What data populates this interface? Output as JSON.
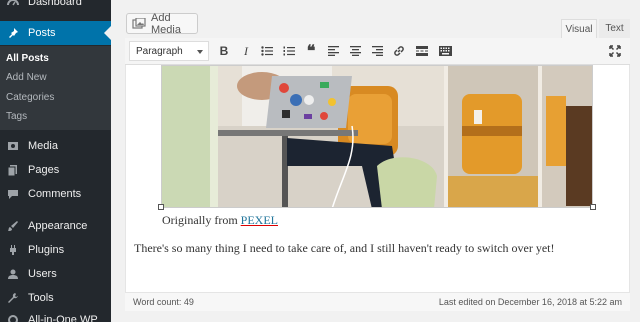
{
  "sidebar": {
    "items": [
      {
        "label": "Dashboard",
        "icon": "dashboard-icon"
      },
      {
        "label": "Posts",
        "icon": "pin-icon"
      },
      {
        "label": "Media",
        "icon": "media-icon"
      },
      {
        "label": "Pages",
        "icon": "pages-icon"
      },
      {
        "label": "Comments",
        "icon": "comments-icon"
      },
      {
        "label": "Appearance",
        "icon": "brush-icon"
      },
      {
        "label": "Plugins",
        "icon": "plugin-icon"
      },
      {
        "label": "Users",
        "icon": "user-icon"
      },
      {
        "label": "Tools",
        "icon": "wrench-icon"
      },
      {
        "label": "All-in-One WP",
        "icon": "migration-icon"
      }
    ],
    "posts_submenu": [
      "All Posts",
      "Add New",
      "Categories",
      "Tags"
    ]
  },
  "editor": {
    "add_media_label": "Add Media",
    "tabs": [
      "Visual",
      "Text"
    ],
    "format_select_value": "Paragraph",
    "caption_prefix": "Originally from ",
    "caption_link": "PEXEL",
    "paragraph": "There's so many thing I need to take care of, and I still haven't ready to switch over yet!",
    "word_count": "Word count: 49",
    "last_edited": "Last edited on December 16, 2018 at 5:22 am"
  },
  "colors": {
    "sidebar_bg": "#23282d",
    "accent": "#0073aa",
    "link": "#21759b"
  }
}
